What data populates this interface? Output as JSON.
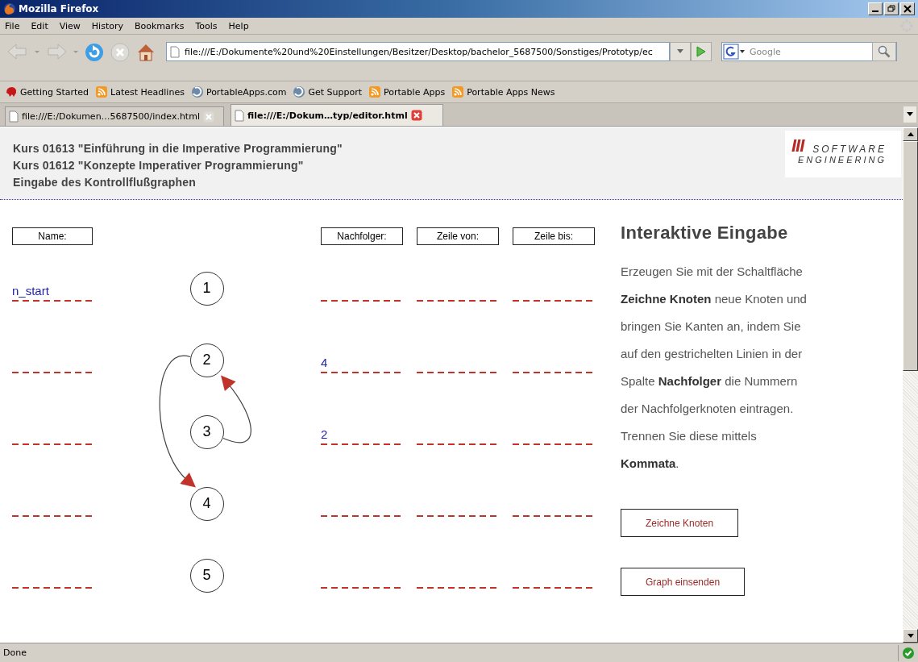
{
  "window": {
    "title": "Mozilla Firefox"
  },
  "menu": [
    "File",
    "Edit",
    "View",
    "History",
    "Bookmarks",
    "Tools",
    "Help"
  ],
  "address_bar": {
    "value": "file:///E:/Dokumente%20und%20Einstellungen/Besitzer/Desktop/bachelor_5687500/Sonstiges/Prototyp/ec"
  },
  "search": {
    "placeholder": "Google"
  },
  "bookmarks": [
    {
      "label": "Getting Started",
      "kind": "start"
    },
    {
      "label": "Latest Headlines",
      "kind": "feed"
    },
    {
      "label": "PortableApps.com",
      "kind": "globe"
    },
    {
      "label": "Get Support",
      "kind": "globe"
    },
    {
      "label": "Portable Apps",
      "kind": "feed"
    },
    {
      "label": "Portable Apps News",
      "kind": "feed"
    }
  ],
  "tabs": [
    {
      "label": "file:///E:/Dokumen…5687500/index.html",
      "selected": false
    },
    {
      "label": "file:///E:/Dokum…typ/editor.html",
      "selected": true
    }
  ],
  "page": {
    "header_lines": [
      "Kurs 01613 \"Einführung in die Imperative Programmierung\"",
      "Kurs 01612 \"Konzepte Imperativer Programmierung\"",
      "Eingabe des Kontrollflußgraphen"
    ],
    "logo": {
      "mark": "III",
      "line1": "SOFTWARE",
      "line2": "ENGINEERING"
    },
    "columns": [
      "Name:",
      "Nachfolger:",
      "Zeile von:",
      "Zeile bis:"
    ],
    "rows": [
      {
        "node": "1",
        "name": "n_start",
        "kind": "plain"
      },
      {
        "node": "2",
        "successors": "4",
        "kind": "down"
      },
      {
        "node": "3",
        "successors": "2",
        "kind": "up"
      },
      {
        "node": "4",
        "kind": "plain"
      },
      {
        "node": "5",
        "kind": "plain"
      }
    ],
    "panel": {
      "title": "Interaktive Eingabe",
      "text": "Erzeugen Sie mit der Schaltfläche **Zeichne Knoten** neue Knoten und bringen Sie Kanten an, indem Sie auf den gestrichelten Linien in der Spalte **Nachfolger** die Nummern der Nachfolgerknoten eintragen. Trennen Sie diese mittels **Kommata**.",
      "buttons": [
        "Zeichne Knoten",
        "Graph einsenden"
      ]
    }
  },
  "status_bar": {
    "text": "Done"
  }
}
